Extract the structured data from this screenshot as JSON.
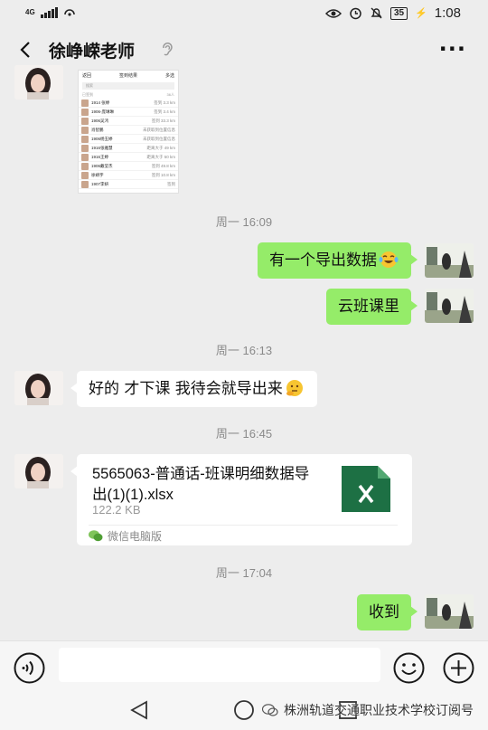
{
  "status_bar": {
    "network": "4G",
    "battery": "35",
    "time": "1:08"
  },
  "header": {
    "title": "徐峥嵘老师",
    "more_label": "···"
  },
  "shared_screenshot": {
    "tabs": [
      "返回",
      "签到结果",
      "多选"
    ],
    "search_placeholder": "搜索",
    "list_header": "已签到",
    "list_count": "36人",
    "rows": [
      {
        "name": "1914 张婷",
        "status": "签到 3.3 km"
      },
      {
        "name": "1906-庞琳琳",
        "status": "签到 3.4 km"
      },
      {
        "name": "1906吴鸿",
        "status": "签到 33.3 km"
      },
      {
        "name": "肖智鹏",
        "status": "未获取到位置信息"
      },
      {
        "name": "1906杨玉婷",
        "status": "未获取到位置信息"
      },
      {
        "name": "1916张雅慧",
        "status": "距离大于 49 km"
      },
      {
        "name": "1916王婷",
        "status": "距离大于 50 km"
      },
      {
        "name": "1906戴莹杰",
        "status": "签到 49.8 km"
      },
      {
        "name": "徐靖宇",
        "status": "签到 10.8 km"
      },
      {
        "name": "1907李妍",
        "status": "签到"
      }
    ]
  },
  "messages": {
    "ts1": "周一 16:09",
    "msg1": "有一个导出数据",
    "msg2": "云班课里",
    "ts2": "周一 16:13",
    "msg3": "好的 才下课 我待会就导出来",
    "ts3": "周一 16:45",
    "file_name": "5565063-普通话-班课明细数据导出(1)(1).xlsx",
    "file_size": "122.2 KB",
    "file_source": "微信电脑版",
    "ts4": "周一 17:04",
    "msg4": "收到"
  },
  "input": {
    "placeholder": ""
  },
  "watermark": "株洲轨道交通职业技术学校订阅号",
  "colors": {
    "chat_background": "#ededed",
    "sent_bubble": "#95ec69",
    "received_bubble": "#ffffff",
    "excel_green": "#1d7044"
  },
  "icons": [
    "back-arrow-icon",
    "ear-icon",
    "voice-icon",
    "emoji-icon",
    "plus-icon",
    "excel-file-icon",
    "wechat-icon",
    "nav-back-icon",
    "nav-home-icon",
    "nav-recents-icon"
  ]
}
